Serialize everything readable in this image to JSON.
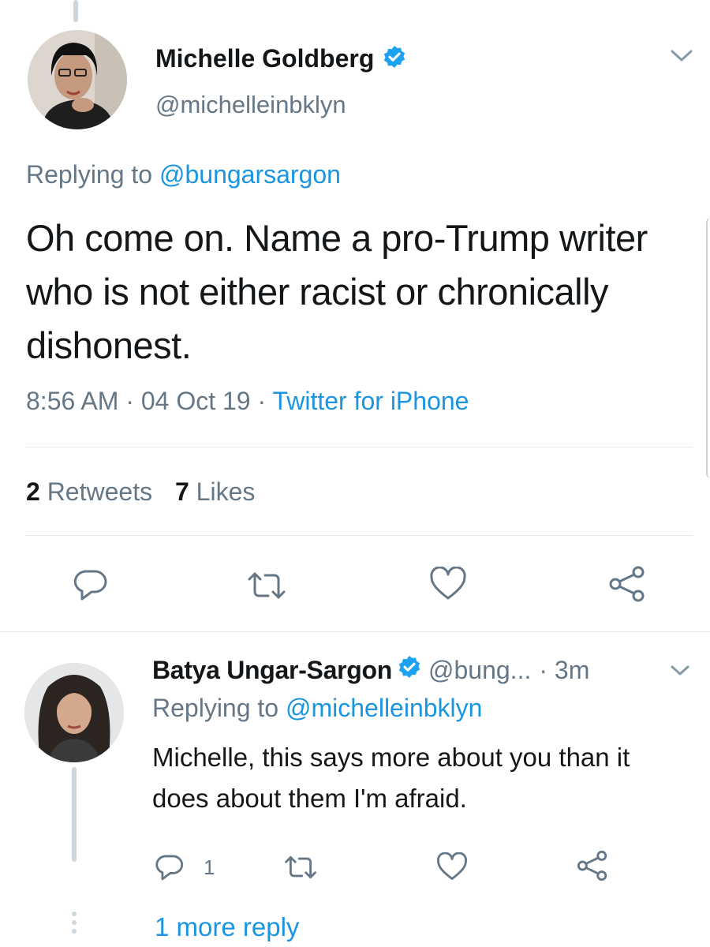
{
  "main_tweet": {
    "author_name": "Michelle Goldberg",
    "handle": "@michelleinbklyn",
    "replying_prefix": "Replying to",
    "replying_to": "@bungarsargon",
    "text": "Oh come on. Name a pro-Trump writer who is not either racist or chronically dishonest.",
    "time": "8:56 AM",
    "date": "04 Oct 19",
    "source": "Twitter for iPhone",
    "retweets_count": "2",
    "retweets_label": "Retweets",
    "likes_count": "7",
    "likes_label": "Likes"
  },
  "reply_tweet": {
    "author_name": "Batya Ungar-Sargon",
    "handle": "@bung...",
    "time_ago": "· 3m",
    "replying_prefix": "Replying to",
    "replying_to": "@michelleinbklyn",
    "text": "Michelle, this says more about you than it does about them I'm afraid.",
    "reply_count": "1"
  },
  "more_replies": "1 more reply",
  "separators": {
    "dot": "·"
  },
  "colors": {
    "link": "#1b95e0",
    "secondary": "#657786",
    "verified": "#1da1f2",
    "divider": "#e1e8ed"
  },
  "icons": [
    "chevron-down-icon",
    "verified-badge-icon",
    "reply-icon",
    "retweet-icon",
    "like-icon",
    "share-icon"
  ]
}
